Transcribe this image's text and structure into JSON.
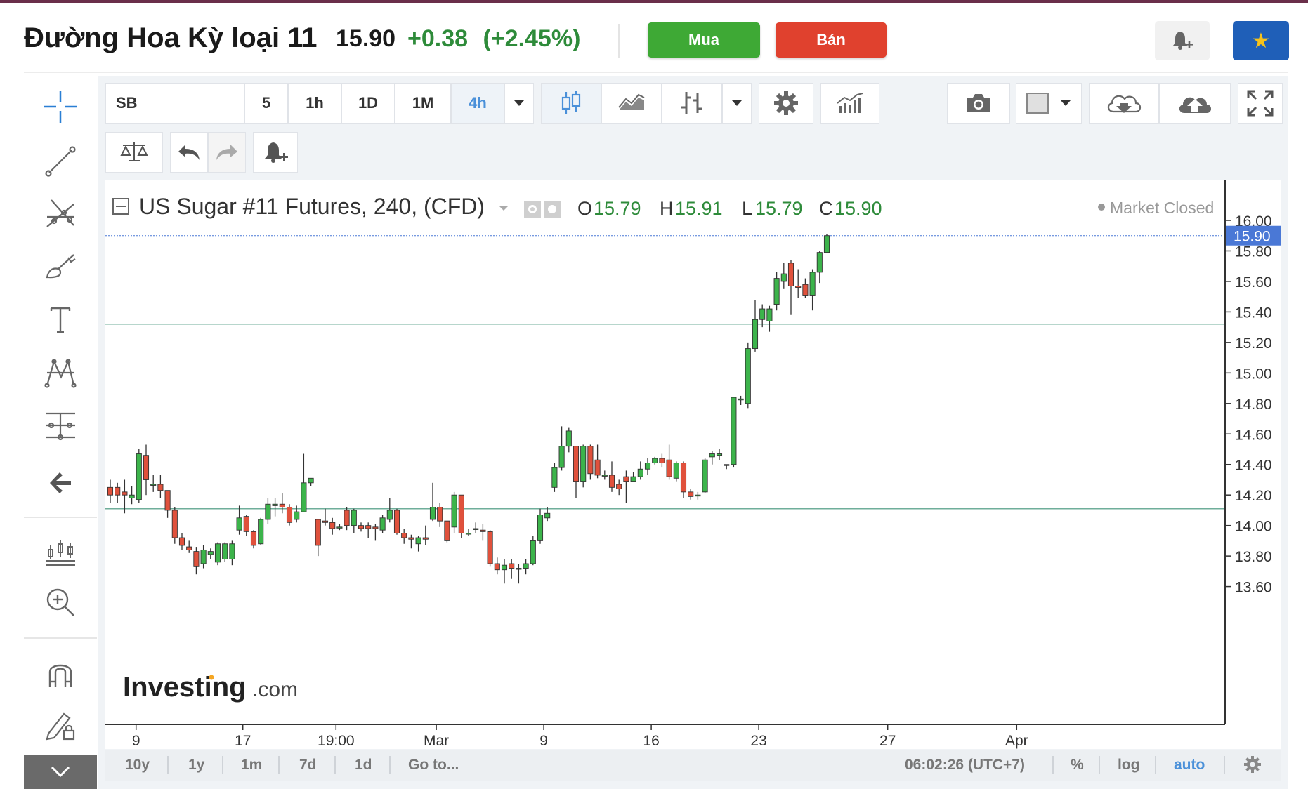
{
  "header": {
    "title": "Đường Hoa Kỳ loại 11",
    "price": "15.90",
    "change": "+0.38",
    "change_pct": "(+2.45%)",
    "buy_label": "Mua",
    "sell_label": "Bán"
  },
  "toolbar": {
    "symbol": "SB",
    "intervals": [
      "5",
      "1h",
      "1D",
      "1M",
      "4h"
    ],
    "active_interval": "4h"
  },
  "legend": {
    "name": "US Sugar #11 Futures, 240, (CFD)",
    "o_label": "O",
    "o_value": "15.79",
    "h_label": "H",
    "h_value": "15.91",
    "l_label": "L",
    "l_value": "15.79",
    "c_label": "C",
    "c_value": "15.90",
    "status": "Market Closed"
  },
  "watermark": {
    "brand": "Investing",
    "suffix": ".com"
  },
  "time_bar": {
    "ranges": [
      "10y",
      "1y",
      "1m",
      "7d",
      "1d"
    ],
    "goto": "Go to...",
    "clock": "06:02:26 (UTC+7)",
    "pct": "%",
    "log": "log",
    "auto": "auto"
  },
  "colors": {
    "up": "#3cb44b",
    "down": "#e0513c",
    "accent": "#4a90d9",
    "last_price_tag": "#4a78d6",
    "hline": "#6fae9a"
  },
  "chart_data": {
    "type": "candlestick",
    "title": "US Sugar #11 Futures, 240, (CFD)",
    "ylim": [
      13.45,
      16.1
    ],
    "y_ticks": [
      16.0,
      15.8,
      15.6,
      15.4,
      15.2,
      15.0,
      14.8,
      14.6,
      14.4,
      14.2,
      14.0,
      13.8,
      13.6
    ],
    "y_tick_labels": [
      "16.00",
      "15.80",
      "15.60",
      "15.40",
      "15.20",
      "15.00",
      "14.80",
      "14.60",
      "14.40",
      "14.20",
      "14.00",
      "13.80",
      "13.60"
    ],
    "x_labels": [
      {
        "label": "9",
        "bar": 3.6
      },
      {
        "label": "17",
        "bar": 18.5
      },
      {
        "label": "19:00",
        "bar": 31.5
      },
      {
        "label": "Mar",
        "bar": 45.5
      },
      {
        "label": "9",
        "bar": 60.5
      },
      {
        "label": "16",
        "bar": 75.5
      },
      {
        "label": "23",
        "bar": 90.5
      },
      {
        "label": "27",
        "bar": 108.5
      },
      {
        "label": "Apr",
        "bar": 126.5
      }
    ],
    "last_price": "15.90",
    "horizontal_lines": [
      15.32,
      14.11
    ],
    "candles": [
      [
        14.25,
        14.2,
        14.3,
        14.15
      ],
      [
        14.25,
        14.2,
        14.28,
        14.15
      ],
      [
        14.22,
        14.2,
        14.3,
        14.08
      ],
      [
        14.18,
        14.2,
        14.26,
        14.14
      ],
      [
        14.17,
        14.47,
        14.5,
        14.15
      ],
      [
        14.46,
        14.3,
        14.53,
        14.2
      ],
      [
        14.27,
        14.27,
        14.33,
        14.22
      ],
      [
        14.27,
        14.23,
        14.33,
        14.18
      ],
      [
        14.23,
        14.1,
        14.23,
        14.05
      ],
      [
        14.1,
        13.92,
        14.12,
        13.88
      ],
      [
        13.92,
        13.87,
        13.95,
        13.84
      ],
      [
        13.86,
        13.84,
        13.9,
        13.82
      ],
      [
        13.83,
        13.73,
        13.86,
        13.68
      ],
      [
        13.75,
        13.84,
        13.87,
        13.72
      ],
      [
        13.81,
        13.83,
        13.85,
        13.78
      ],
      [
        13.76,
        13.88,
        13.89,
        13.74
      ],
      [
        13.78,
        13.88,
        13.89,
        13.76
      ],
      [
        13.78,
        13.88,
        13.9,
        13.74
      ],
      [
        13.97,
        14.05,
        14.13,
        13.94
      ],
      [
        14.06,
        13.96,
        14.07,
        13.93
      ],
      [
        13.96,
        13.87,
        13.97,
        13.85
      ],
      [
        13.88,
        14.04,
        14.05,
        13.87
      ],
      [
        14.04,
        14.14,
        14.18,
        14.01
      ],
      [
        14.13,
        14.14,
        14.18,
        14.06
      ],
      [
        14.14,
        14.12,
        14.21,
        14.08
      ],
      [
        14.12,
        14.02,
        14.14,
        14.0
      ],
      [
        14.04,
        14.09,
        14.13,
        14.02
      ],
      [
        14.09,
        14.28,
        14.47,
        14.1
      ],
      [
        14.28,
        14.31,
        14.31,
        14.26
      ],
      [
        14.04,
        13.87,
        14.04,
        13.8
      ],
      [
        14.03,
        14.02,
        14.11,
        14.0
      ],
      [
        14.02,
        13.98,
        14.05,
        13.94
      ],
      [
        13.99,
        13.99,
        14.01,
        13.97
      ],
      [
        14.1,
        14.0,
        14.12,
        13.97
      ],
      [
        14.0,
        14.1,
        14.11,
        13.95
      ],
      [
        14.0,
        13.98,
        14.02,
        13.96
      ],
      [
        14.0,
        13.98,
        14.02,
        13.92
      ],
      [
        13.99,
        13.98,
        14.01,
        13.9
      ],
      [
        13.97,
        14.05,
        14.07,
        13.95
      ],
      [
        14.04,
        14.1,
        14.18,
        14.02
      ],
      [
        14.1,
        13.95,
        14.11,
        13.94
      ],
      [
        13.95,
        13.92,
        13.98,
        13.88
      ],
      [
        13.92,
        13.91,
        13.94,
        13.85
      ],
      [
        13.88,
        13.92,
        13.93,
        13.83
      ],
      [
        13.92,
        13.91,
        14.0,
        13.87
      ],
      [
        14.04,
        14.12,
        14.28,
        14.03
      ],
      [
        14.12,
        14.03,
        14.15,
        13.99
      ],
      [
        14.03,
        13.9,
        14.03,
        13.89
      ],
      [
        13.99,
        14.2,
        14.22,
        13.95
      ],
      [
        14.2,
        13.95,
        14.2,
        13.92
      ],
      [
        13.95,
        13.95,
        13.98,
        13.93
      ],
      [
        13.98,
        13.98,
        14.02,
        13.95
      ],
      [
        13.97,
        13.96,
        14.01,
        13.9
      ],
      [
        13.96,
        13.75,
        13.97,
        13.73
      ],
      [
        13.75,
        13.71,
        13.79,
        13.68
      ],
      [
        13.71,
        13.74,
        13.78,
        13.62
      ],
      [
        13.75,
        13.72,
        13.78,
        13.65
      ],
      [
        13.72,
        13.72,
        13.75,
        13.62
      ],
      [
        13.72,
        13.75,
        13.78,
        13.68
      ],
      [
        13.75,
        13.9,
        13.93,
        13.74
      ],
      [
        13.9,
        14.07,
        14.11,
        13.88
      ],
      [
        14.05,
        14.08,
        14.12,
        14.03
      ],
      [
        14.25,
        14.38,
        14.41,
        14.22
      ],
      [
        14.38,
        14.52,
        14.65,
        14.36
      ],
      [
        14.52,
        14.62,
        14.64,
        14.48
      ],
      [
        14.52,
        14.29,
        14.52,
        14.18
      ],
      [
        14.29,
        14.52,
        14.53,
        14.25
      ],
      [
        14.52,
        14.34,
        14.53,
        14.3
      ],
      [
        14.43,
        14.33,
        14.53,
        14.31
      ],
      [
        14.33,
        14.33,
        14.36,
        14.3
      ],
      [
        14.33,
        14.25,
        14.42,
        14.22
      ],
      [
        14.27,
        14.24,
        14.3,
        14.2
      ],
      [
        14.32,
        14.29,
        14.36,
        14.15
      ],
      [
        14.29,
        14.32,
        14.35,
        14.3
      ],
      [
        14.32,
        14.37,
        14.42,
        14.3
      ],
      [
        14.37,
        14.41,
        14.44,
        14.33
      ],
      [
        14.41,
        14.44,
        14.45,
        14.4
      ],
      [
        14.44,
        14.41,
        14.47,
        14.38
      ],
      [
        14.43,
        14.32,
        14.53,
        14.3
      ],
      [
        14.31,
        14.41,
        14.42,
        14.29
      ],
      [
        14.41,
        14.22,
        14.42,
        14.18
      ],
      [
        14.22,
        14.19,
        14.24,
        14.17
      ],
      [
        14.2,
        14.2,
        14.22,
        14.17
      ],
      [
        14.22,
        14.43,
        14.44,
        14.21
      ],
      [
        14.45,
        14.47,
        14.49,
        14.4
      ],
      [
        14.46,
        14.47,
        14.5,
        14.43
      ],
      [
        14.4,
        14.4,
        14.4,
        14.37
      ],
      [
        14.4,
        14.84,
        14.84,
        14.38
      ],
      [
        14.83,
        14.83,
        14.85,
        14.79
      ],
      [
        14.8,
        15.16,
        15.2,
        14.77
      ],
      [
        15.16,
        15.35,
        15.48,
        15.14
      ],
      [
        15.35,
        15.42,
        15.45,
        15.3
      ],
      [
        15.34,
        15.42,
        15.44,
        15.27
      ],
      [
        15.45,
        15.62,
        15.66,
        15.41
      ],
      [
        15.6,
        15.65,
        15.72,
        15.55
      ],
      [
        15.72,
        15.57,
        15.74,
        15.38
      ],
      [
        15.57,
        15.56,
        15.68,
        15.49
      ],
      [
        15.58,
        15.51,
        15.62,
        15.49
      ],
      [
        15.51,
        15.66,
        15.68,
        15.41
      ],
      [
        15.66,
        15.79,
        15.8,
        15.59
      ],
      [
        15.79,
        15.9,
        15.91,
        15.79
      ]
    ]
  }
}
